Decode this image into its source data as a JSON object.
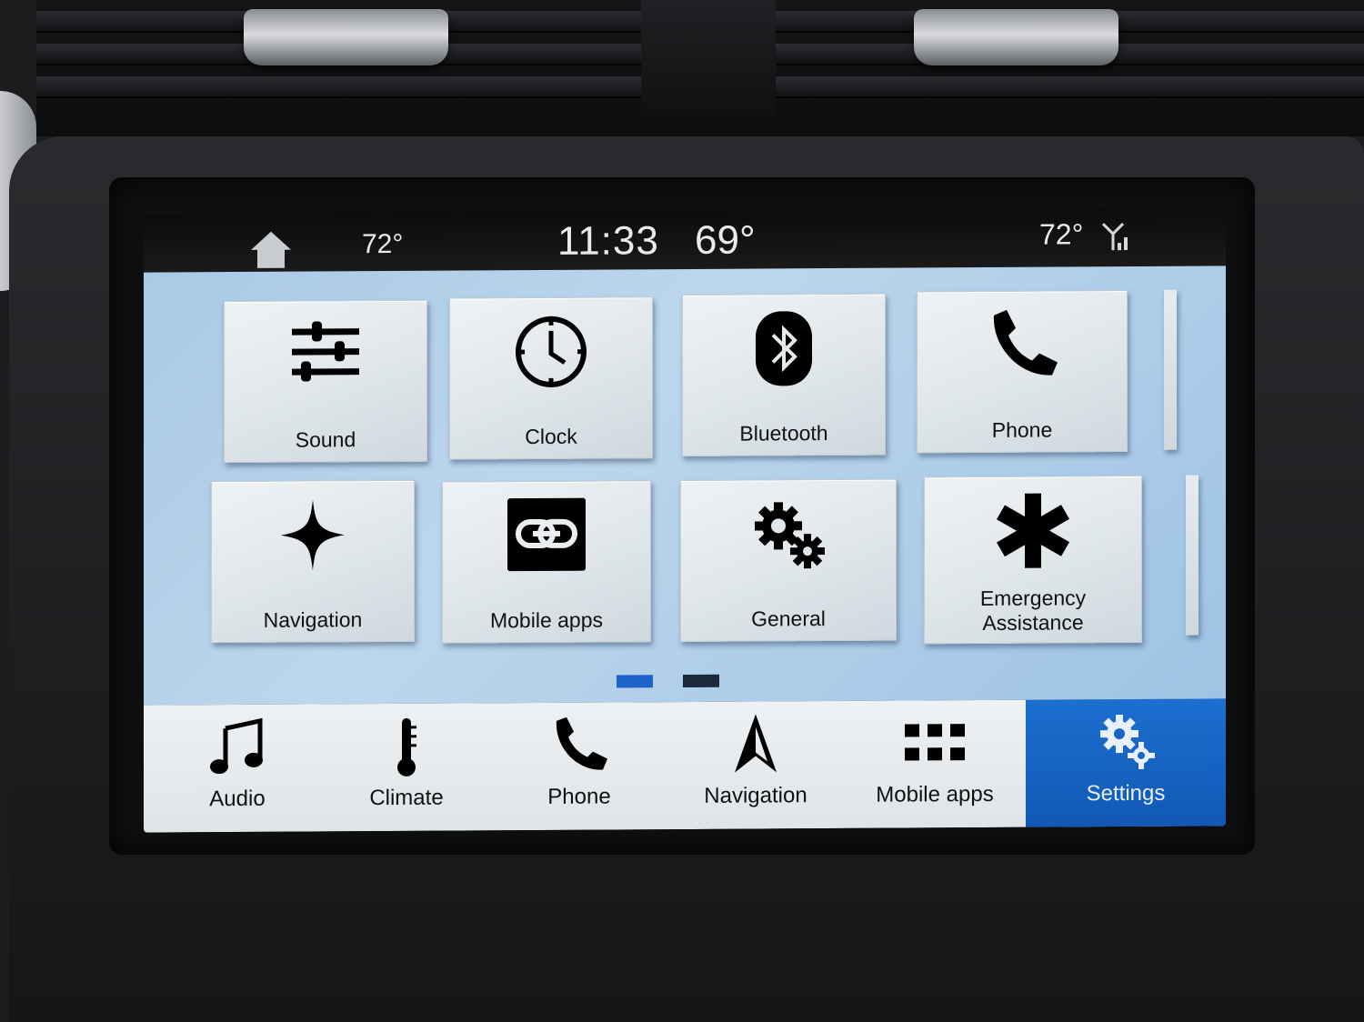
{
  "status_bar": {
    "home_icon": "home-icon",
    "left_temp": "72°",
    "clock": "11:33",
    "outside_temp": "69°",
    "right_temp": "72°",
    "signal_icon": "signal-icon"
  },
  "settings_grid": {
    "tiles": [
      {
        "label": "Sound",
        "icon": "sliders-icon"
      },
      {
        "label": "Clock",
        "icon": "clock-icon"
      },
      {
        "label": "Bluetooth",
        "icon": "bluetooth-icon"
      },
      {
        "label": "Phone",
        "icon": "phone-icon"
      },
      {
        "label": "Navigation",
        "icon": "compass-star-icon"
      },
      {
        "label": "Mobile apps",
        "icon": "link-icon"
      },
      {
        "label": "General",
        "icon": "gears-icon"
      },
      {
        "label": "Emergency Assistance",
        "icon": "asterisk-icon"
      }
    ],
    "pages": {
      "current": 1,
      "total": 2
    }
  },
  "nav_bar": {
    "items": [
      {
        "label": "Audio",
        "icon": "music-note-icon"
      },
      {
        "label": "Climate",
        "icon": "thermometer-icon"
      },
      {
        "label": "Phone",
        "icon": "phone-icon"
      },
      {
        "label": "Navigation",
        "icon": "navigation-arrow-icon"
      },
      {
        "label": "Mobile apps",
        "icon": "apps-grid-icon"
      },
      {
        "label": "Settings",
        "icon": "gears-icon"
      }
    ],
    "active": "Settings"
  },
  "colors": {
    "active_tab": "#1a66c6",
    "page_dot_active": "#1e63c8",
    "page_dot_inactive": "#1e2a3a",
    "content_bg": "#b0cde8"
  }
}
